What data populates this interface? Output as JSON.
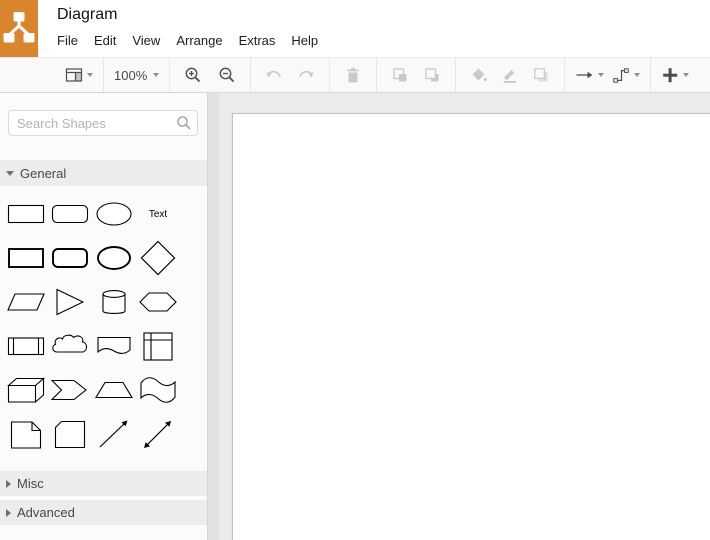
{
  "window": {
    "title": "Diagram"
  },
  "logo": {
    "icon": "tree-diagram-icon",
    "color": "#d9852b"
  },
  "menu": {
    "items": [
      "File",
      "Edit",
      "View",
      "Arrange",
      "Extras",
      "Help"
    ]
  },
  "toolbar": {
    "zoom_level": "100%",
    "buttons": [
      {
        "name": "page-view",
        "icon": "page-view-icon",
        "enabled": true,
        "dropdown": true
      },
      {
        "name": "zoom-level",
        "icon": "zoom-level-dropdown",
        "enabled": true,
        "dropdown": true,
        "label": "100%"
      },
      {
        "name": "zoom-in",
        "icon": "magnifier-plus-icon",
        "enabled": true,
        "dropdown": false
      },
      {
        "name": "zoom-out",
        "icon": "magnifier-minus-icon",
        "enabled": true,
        "dropdown": false
      },
      {
        "name": "undo",
        "icon": "undo-arrow-icon",
        "enabled": false,
        "dropdown": false
      },
      {
        "name": "redo",
        "icon": "redo-arrow-icon",
        "enabled": false,
        "dropdown": false
      },
      {
        "name": "delete",
        "icon": "trash-icon",
        "enabled": false,
        "dropdown": false
      },
      {
        "name": "to-front",
        "icon": "bring-to-front-icon",
        "enabled": false,
        "dropdown": false
      },
      {
        "name": "to-back",
        "icon": "send-to-back-icon",
        "enabled": false,
        "dropdown": false
      },
      {
        "name": "fill-color",
        "icon": "paint-bucket-icon",
        "enabled": false,
        "dropdown": false
      },
      {
        "name": "line-color",
        "icon": "pencil-line-icon",
        "enabled": false,
        "dropdown": false
      },
      {
        "name": "shadow",
        "icon": "shadow-square-icon",
        "enabled": false,
        "dropdown": false
      },
      {
        "name": "connection",
        "icon": "arrow-right-icon",
        "enabled": true,
        "dropdown": true
      },
      {
        "name": "waypoints",
        "icon": "elbow-connector-icon",
        "enabled": true,
        "dropdown": true
      },
      {
        "name": "insert",
        "icon": "plus-icon",
        "enabled": true,
        "dropdown": true
      }
    ]
  },
  "sidebar": {
    "search": {
      "placeholder": "Search Shapes",
      "icon": "search-icon"
    },
    "sections": [
      {
        "label": "General",
        "expanded": true
      },
      {
        "label": "Misc",
        "expanded": false
      },
      {
        "label": "Advanced",
        "expanded": false
      }
    ],
    "shapes": [
      "rectangle",
      "rounded-rectangle",
      "ellipse",
      "text",
      "square",
      "rounded-square",
      "circle",
      "diamond",
      "parallelogram",
      "triangle",
      "cylinder",
      "hexagon",
      "process",
      "cloud",
      "document",
      "internal-storage",
      "cube",
      "step",
      "trapezoid",
      "tape",
      "note",
      "card",
      "line",
      "bidirectional-arrow"
    ],
    "text_shape_label": "Text"
  },
  "colors": {
    "brand_orange": "#d9852b",
    "toolbar_icon_enabled": "#4d4d4d",
    "toolbar_icon_disabled": "#c9c9c9",
    "canvas_background": "#ebebeb",
    "page_background": "#ffffff"
  }
}
